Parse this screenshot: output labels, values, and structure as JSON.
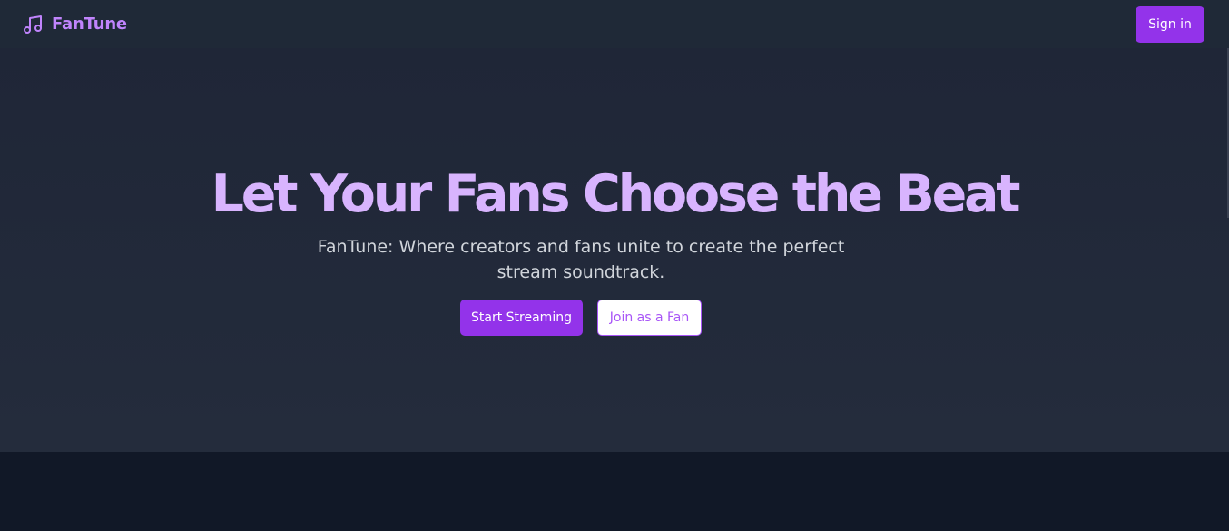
{
  "header": {
    "brand_name": "FanTune",
    "brand_icon": "music-note-icon",
    "signin_label": "Sign in"
  },
  "hero": {
    "title": "Let Your Fans Choose the Beat",
    "subtitle": "FanTune: Where creators and fans unite to create the perfect stream soundtrack.",
    "primary_label": "Start Streaming",
    "secondary_label": "Join as a Fan"
  },
  "colors": {
    "accent": "#9333ea",
    "accent_light": "#c084fc",
    "title": "#d8b4fe",
    "background": "#1f2937",
    "lower_background": "#111827"
  }
}
